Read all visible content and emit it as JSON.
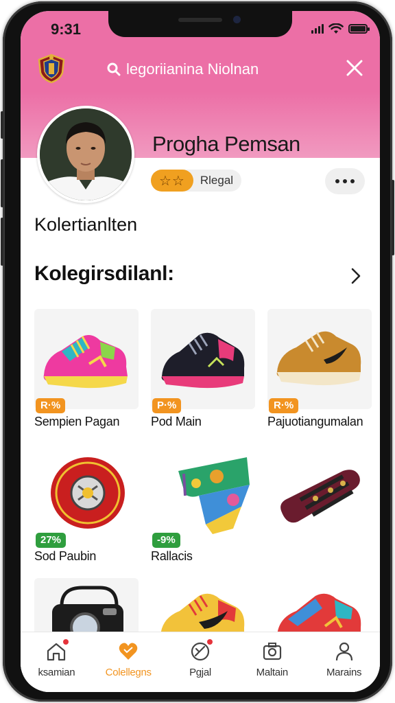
{
  "status": {
    "time": "9:31"
  },
  "header": {
    "search_text": "legoriianina Niolnan"
  },
  "profile": {
    "name": "Progha Pemsan",
    "rating_label": "Rlegal",
    "stars": "☆☆"
  },
  "collection_label": "Kolertianlten",
  "section": {
    "title": "Kolegirsdilanl:"
  },
  "items": [
    {
      "title": "Sempien Pagan",
      "badge": "R·%"
    },
    {
      "title": "Pod Main",
      "badge": "P·%"
    },
    {
      "title": "Pajuotiangumalan",
      "badge": "R·%"
    },
    {
      "title": "Sod Paubin",
      "badge": "27%"
    },
    {
      "title": "Rallacis",
      "badge": "-9%"
    },
    {
      "title": "",
      "badge": ""
    },
    {
      "title": "",
      "badge": ""
    },
    {
      "title": "",
      "badge": ""
    },
    {
      "title": "",
      "badge": ""
    }
  ],
  "tabs": [
    {
      "label": "ksamian",
      "icon": "home-icon"
    },
    {
      "label": "Colellegns",
      "icon": "heart-icon"
    },
    {
      "label": "Pgjal",
      "icon": "tag-icon"
    },
    {
      "label": "Maltain",
      "icon": "camera-icon"
    },
    {
      "label": "Marains",
      "icon": "person-icon"
    }
  ],
  "colors": {
    "header_pink": "#ec6fa6",
    "accent_orange": "#f29420",
    "badge_green": "#2f9e3e"
  }
}
